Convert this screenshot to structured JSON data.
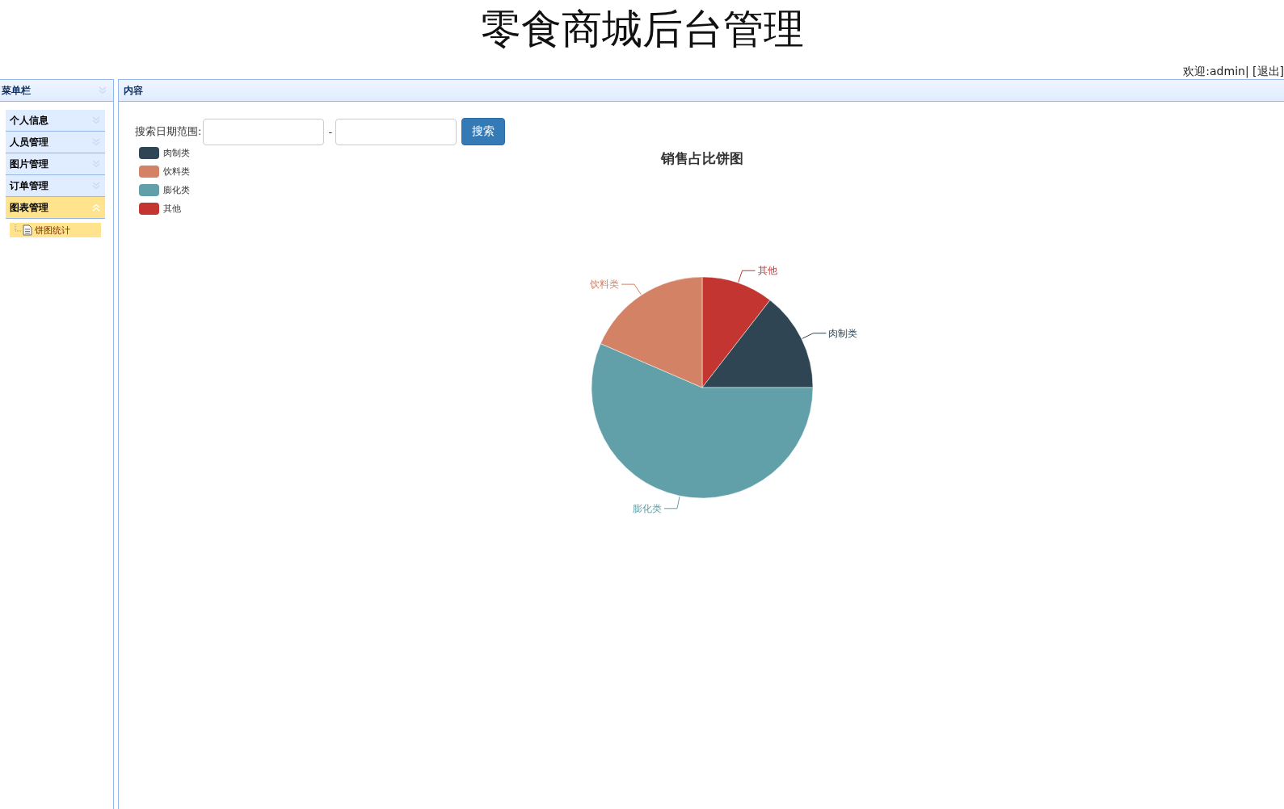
{
  "header": {
    "title": "零食商城后台管理",
    "welcome": "欢迎:admin| [退出]"
  },
  "sidebar": {
    "title": "菜单栏",
    "items": [
      {
        "label": "个人信息",
        "selected": false,
        "expanded": false
      },
      {
        "label": "人员管理",
        "selected": false,
        "expanded": false
      },
      {
        "label": "图片管理",
        "selected": false,
        "expanded": false
      },
      {
        "label": "订单管理",
        "selected": false,
        "expanded": false
      },
      {
        "label": "图表管理",
        "selected": true,
        "expanded": true,
        "children": [
          {
            "label": "饼图统计",
            "selected": true
          }
        ]
      }
    ]
  },
  "content": {
    "title": "内容",
    "search": {
      "label": "搜索日期范围:",
      "separator": "-",
      "button": "搜索"
    },
    "legend": [
      {
        "label": "肉制类",
        "color": "#2f4554"
      },
      {
        "label": "饮料类",
        "color": "#d48265"
      },
      {
        "label": "膨化类",
        "color": "#61a0a8"
      },
      {
        "label": "其他",
        "color": "#c23531"
      }
    ],
    "chart_data": {
      "type": "pie",
      "title": "销售占比饼图",
      "categories": [
        "其他",
        "肉制类",
        "膨化类",
        "饮料类"
      ],
      "series": [
        {
          "colors": [
            "#c23531",
            "#2f4554",
            "#61a0a8",
            "#d48265"
          ],
          "values": [
            10.5,
            14.5,
            56.5,
            18.5
          ]
        }
      ]
    }
  }
}
